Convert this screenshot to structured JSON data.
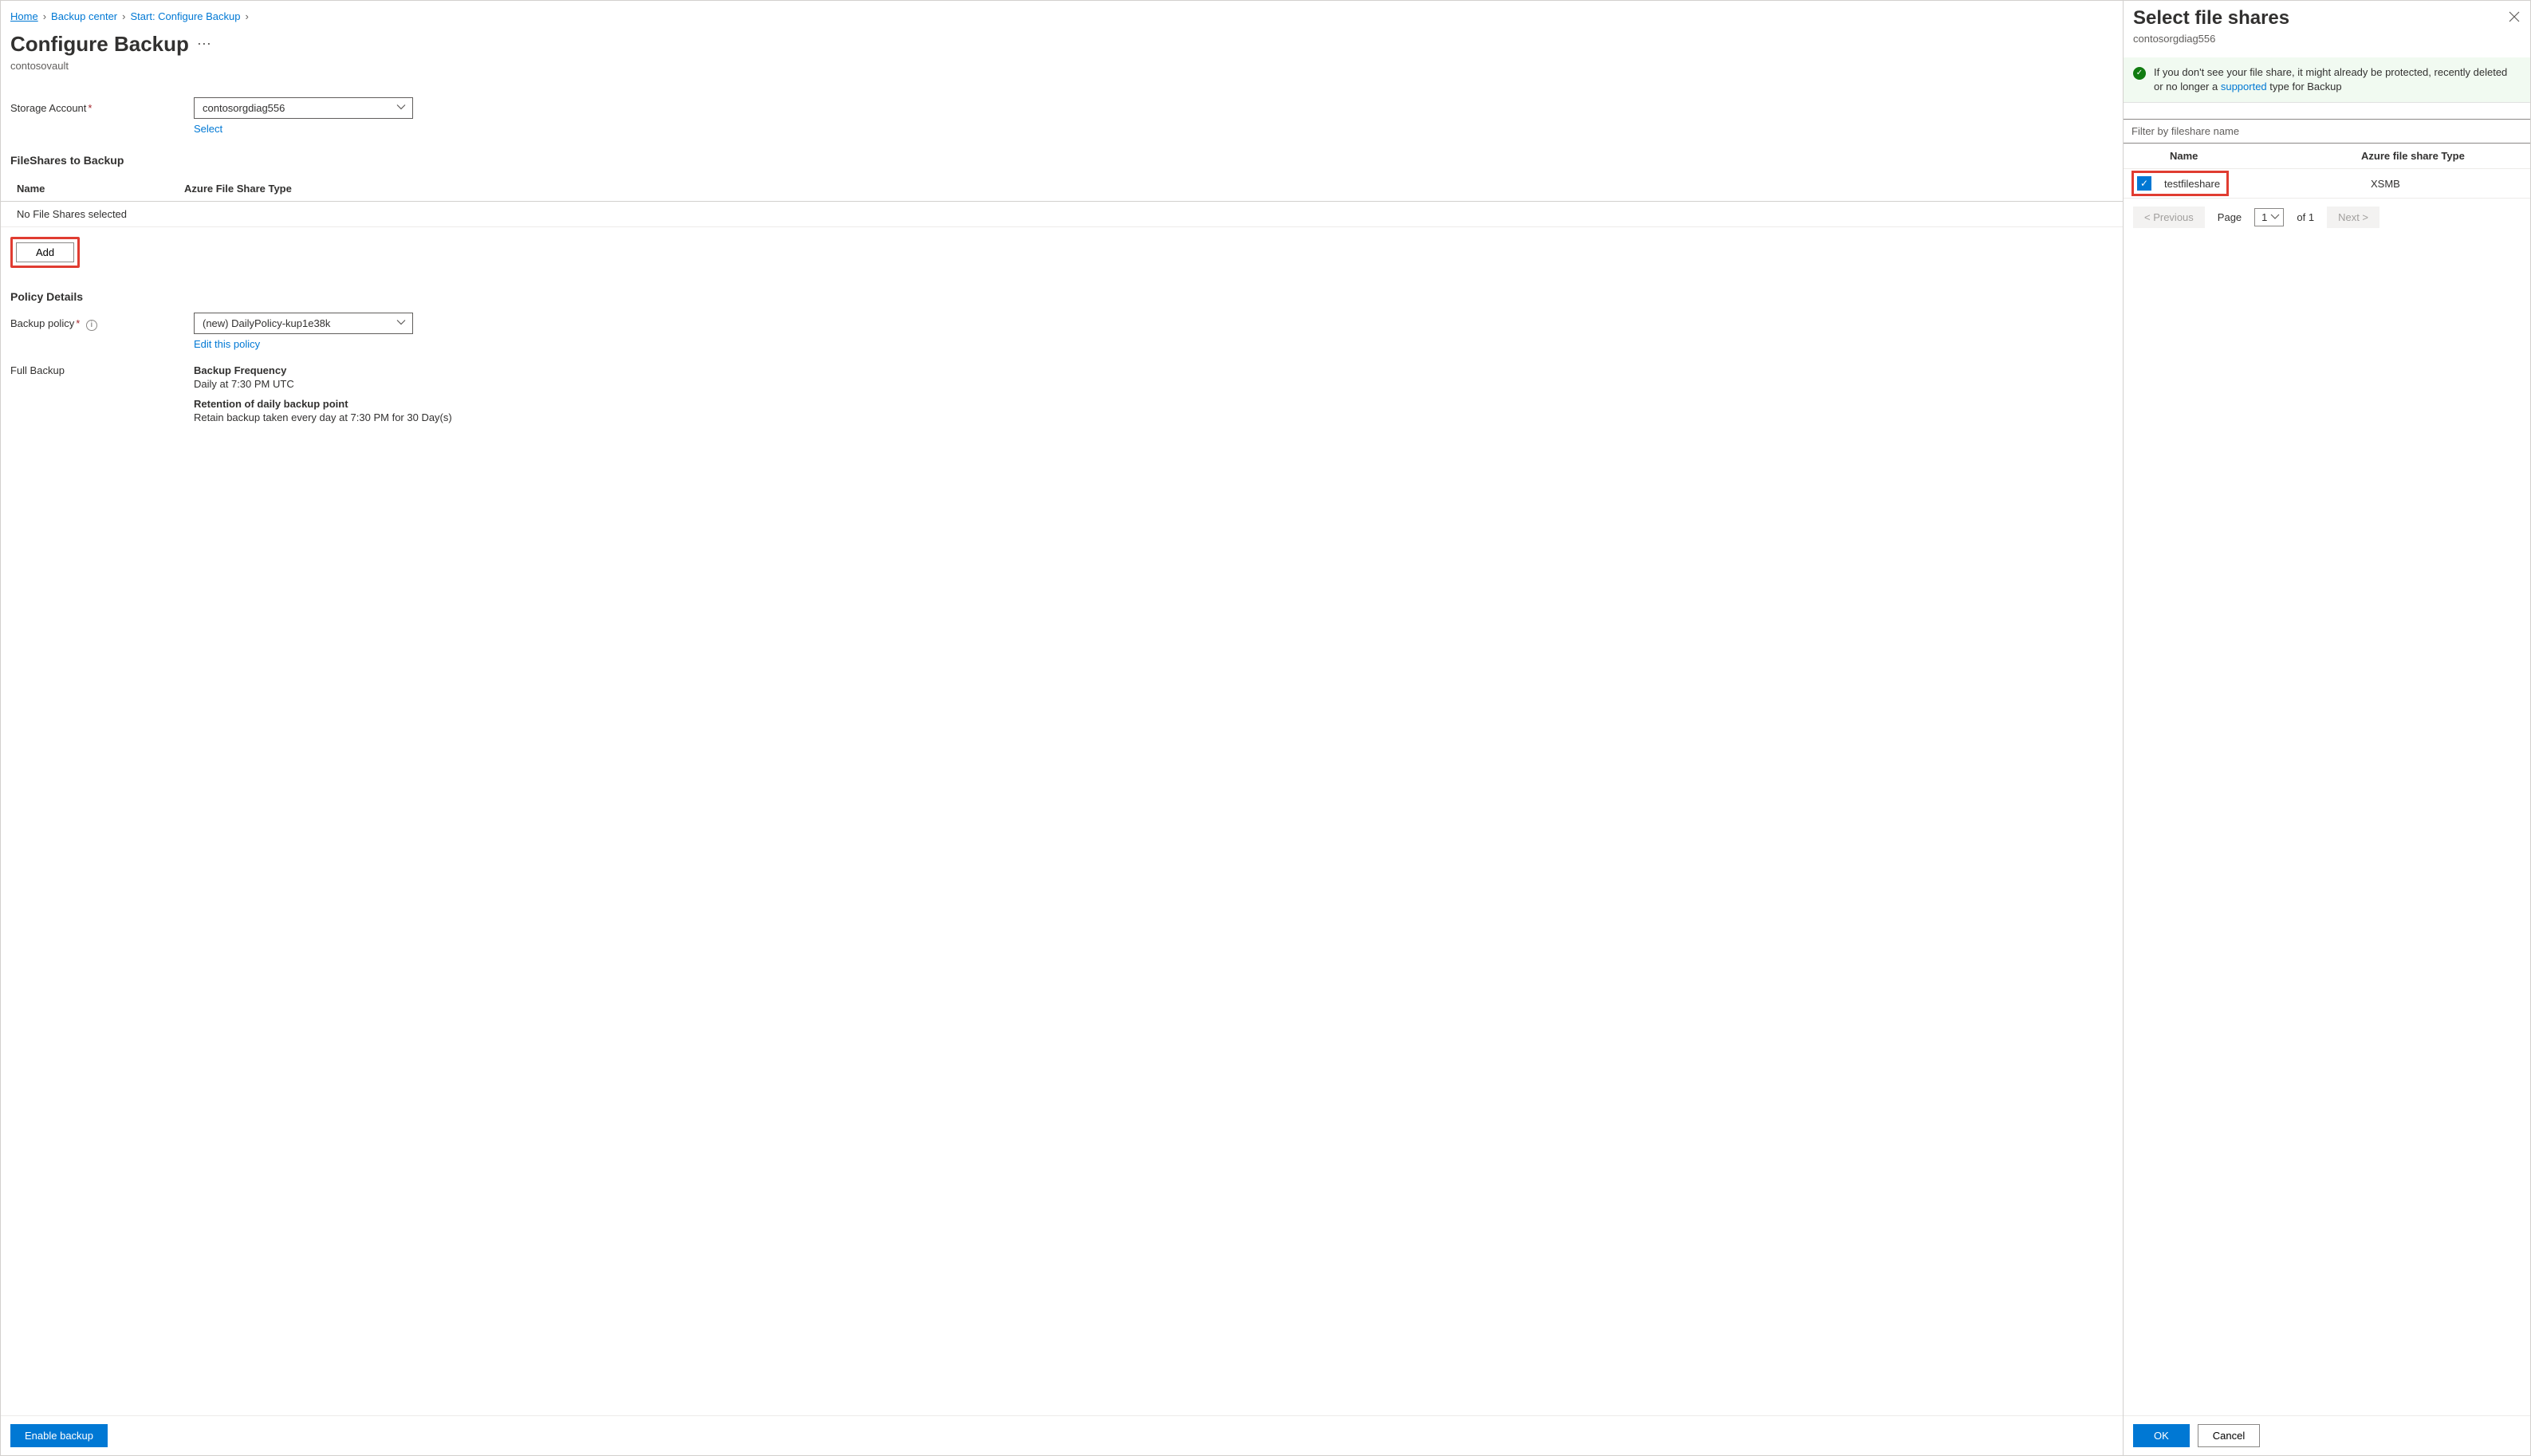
{
  "breadcrumb": {
    "home": "Home",
    "backup_center": "Backup center",
    "start": "Start: Configure Backup"
  },
  "page": {
    "title": "Configure Backup",
    "subtitle": "contosovault"
  },
  "storage": {
    "label": "Storage Account",
    "value": "contosorgdiag556",
    "select_link": "Select"
  },
  "fileshares": {
    "heading": "FileShares to Backup",
    "col_name": "Name",
    "col_type": "Azure File Share Type",
    "empty": "No File Shares selected",
    "add": "Add"
  },
  "policy": {
    "heading": "Policy Details",
    "label": "Backup policy",
    "value": "(new) DailyPolicy-kup1e38k",
    "edit": "Edit this policy",
    "full_backup_label": "Full Backup",
    "freq_head": "Backup Frequency",
    "freq_val": "Daily at 7:30 PM UTC",
    "ret_head": "Retention of daily backup point",
    "ret_val": "Retain backup taken every day at 7:30 PM for 30 Day(s)"
  },
  "footer": {
    "enable": "Enable backup"
  },
  "panel": {
    "title": "Select file shares",
    "subtitle": "contosorgdiag556",
    "info_pre": "If you don't see your file share, it might already be protected, recently deleted or no longer a ",
    "info_link": "supported",
    "info_post": " type for Backup",
    "filter_placeholder": "Filter by fileshare name",
    "col_name": "Name",
    "col_type": "Azure file share Type",
    "row_name": "testfileshare",
    "row_type": "XSMB",
    "prev": "< Previous",
    "page_label": "Page",
    "page_val": "1",
    "page_of": "of 1",
    "next": "Next >",
    "ok": "OK",
    "cancel": "Cancel"
  }
}
